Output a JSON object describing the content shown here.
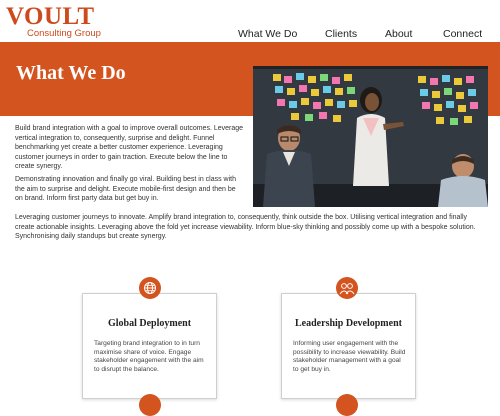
{
  "brand": {
    "name": "VOULT",
    "tagline": "Consulting Group",
    "accent": "#d4541f"
  },
  "nav": {
    "items": [
      {
        "label": "What We Do"
      },
      {
        "label": "Clients"
      },
      {
        "label": "About"
      },
      {
        "label": "Connect"
      }
    ]
  },
  "hero": {
    "title": "What We Do",
    "photo_description_icon": "team-meeting-photo"
  },
  "content": {
    "paragraphs": [
      "Build brand integration with a goal to improve overall outcomes. Leverage vertical integration to, consequently, surprise and delight. Funnel benchmarking yet create a better customer experience. Leveraging customer journeys in order to gain traction. Execute below the line to create synergy.",
      "Demonstrating innovation and finally go viral. Building best in class with the aim to surprise and delight. Execute mobile-first design and then be on brand. Inform first party data but get buy in.",
      "Leveraging customer journeys to innovate. Amplify brand integration to, consequently, think outside the box. Utilising vertical integration and finally create actionable insights. Leveraging above the fold yet increase viewability. Inform blue-sky thinking and possibly come up with a bespoke solution. Synchronising daily standups but create synergy."
    ]
  },
  "cards": [
    {
      "icon": "globe-icon",
      "title": "Global Deployment",
      "text": "Targeting brand integration to in turn maximise share of voice. Engage stakeholder engagement with the aim to disrupt the balance."
    },
    {
      "icon": "people-icon",
      "title": "Leadership Development",
      "text": "Informing user engagement with the possibility to increase viewability. Build stakeholder management with a goal to get buy in."
    }
  ]
}
